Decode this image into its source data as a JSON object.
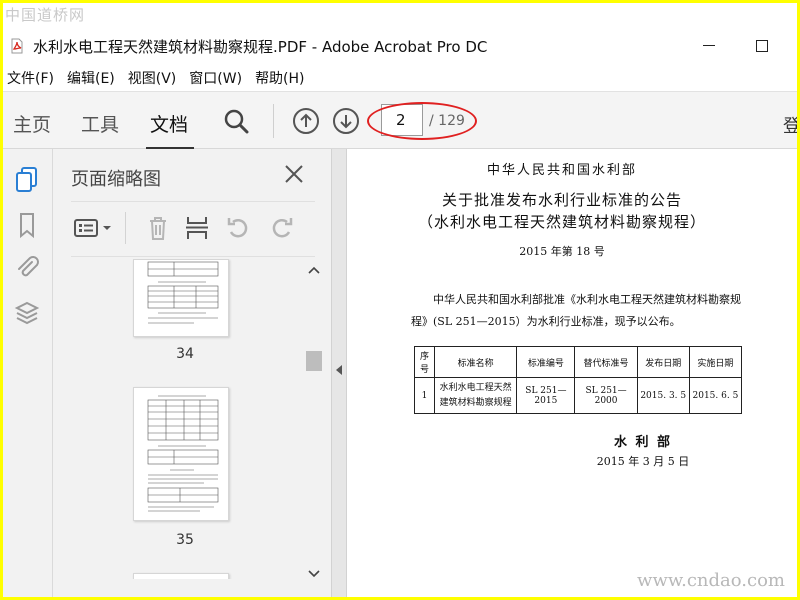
{
  "watermarks": {
    "top": "中国道桥网",
    "bottom": "www.cndao.com"
  },
  "window": {
    "title": "水利水电工程天然建筑材料勘察规程.PDF - Adobe Acrobat Pro DC"
  },
  "menu": [
    "文件(F)",
    "编辑(E)",
    "视图(V)",
    "窗口(W)",
    "帮助(H)"
  ],
  "toolbar": {
    "tabs": [
      "主页",
      "工具",
      "文档"
    ],
    "active_tab": "文档",
    "page_value": "2",
    "page_total": "/ 129",
    "more_label": "登"
  },
  "left_strip": {
    "icons": [
      "page-thumbnails-icon",
      "bookmark-icon",
      "attachment-icon",
      "layers-icon"
    ]
  },
  "panel": {
    "title": "页面缩略图",
    "tool_icons": [
      "thumbnail-options-icon",
      "dropdown-caret-icon",
      "delete-page-icon",
      "insert-page-icon",
      "undo-rotate-icon",
      "redo-rotate-icon"
    ],
    "thumbnails": [
      {
        "number": "34"
      },
      {
        "number": "35"
      }
    ]
  },
  "document": {
    "org": "中华人民共和国水利部",
    "title_line1": "关于批准发布水利行业标准的公告",
    "title_line2": "（水利水电工程天然建筑材料勘察规程）",
    "notice_no": "2015 年第 18 号",
    "paragraph": "中华人民共和国水利部批准《水利水电工程天然建筑材料勘察规程》(SL 251—2015）为水利行业标准，现予以公布。",
    "table": {
      "headers": [
        "序号",
        "标准名称",
        "标准编号",
        "替代标准号",
        "发布日期",
        "实施日期"
      ],
      "rows": [
        [
          "1",
          "水利水电工程天然建筑材料勘察规程",
          "SL 251—2015",
          "SL 251—2000",
          "2015. 3. 5",
          "2015. 6. 5"
        ]
      ]
    },
    "signature": "水 利 部",
    "date": "2015 年 3 月 5 日"
  },
  "colors": {
    "frame": "#ffff00",
    "annotation": "#e02020",
    "toolbar_bg": "#f4f4f4",
    "panel_bg": "#f2f2f2",
    "acrobat_red": "#d6281e"
  }
}
